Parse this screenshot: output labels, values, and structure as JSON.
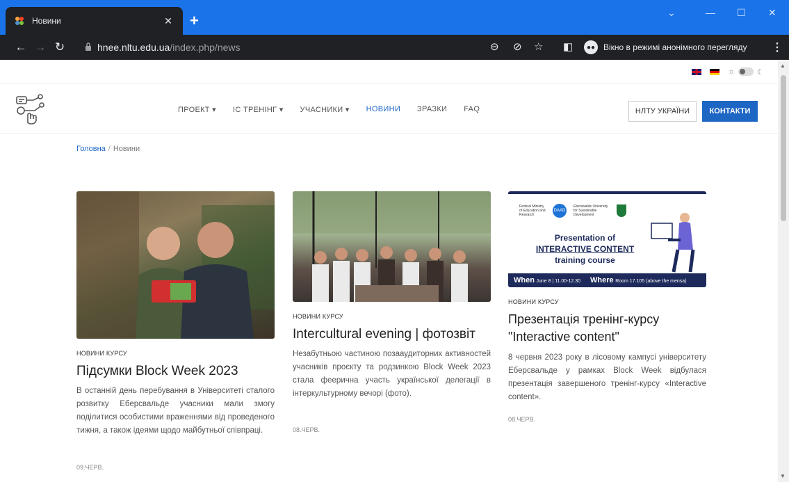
{
  "browser": {
    "tab_title": "Новини",
    "url_host": "hnee.nltu.edu.ua",
    "url_path": "/index.php/news",
    "incognito_label": "Вікно в режимі анонімного перегляду"
  },
  "site": {
    "nav": [
      "ПРОЕКТ ▾",
      "ІС ТРЕНІНГ ▾",
      "УЧАСНИКИ ▾",
      "НОВИНИ",
      "ЗРАЗКИ",
      "FAQ"
    ],
    "active_nav": "НОВИНИ",
    "btn_nltu": "НЛТУ УКРАЇНИ",
    "btn_contacts": "КОНТАКТИ",
    "accent_color": "#1e66c4"
  },
  "breadcrumb": {
    "home": "Головна",
    "current": "Новини"
  },
  "cards": [
    {
      "category": "НОВИНИ КУРСУ",
      "title": "Підсумки Block Week 2023",
      "text": "В останній день перебування в Університеті сталого розвитку Еберсвальде учасники мали змогу поділитися особистими враженнями від проведеного тижня, а також ідеями щодо майбутньої співпраці.",
      "date": "09.ЧЕРВ."
    },
    {
      "category": "НОВИНИ КУРСУ",
      "title": "Intercultural evening | фотозвіт",
      "text": "Незабутньою частиною позааудиторних активностей учасників проєкту та родзинкою Block Week 2023 стала феерична участь української делегації в інтеркультурному вечорі (фото).",
      "date": "08.ЧЕРВ."
    },
    {
      "category": "НОВИНИ КУРСУ",
      "title": "Презентація тренінг-курсу \"Interactive content\"",
      "text": "8 червня 2023 року в лісовому кампусі університету Еберсвальде у рамках Block Week відбулася презентація завершеного тренінг-курсу «Interactive content».",
      "date": "08.ЧЕРВ."
    }
  ],
  "poster": {
    "line1": "Presentation of",
    "line2": "INTERACTIVE CONTENT",
    "line3": "training course",
    "when_label": "When",
    "when_value": "June 8 | 11.00-12.30",
    "where_label": "Where",
    "where_value": "Room 17.105 (above the mensa)",
    "logo_ministry": "Federal Ministry of Education and Research",
    "logo_daad": "DAAD",
    "logo_hnee": "Eberswalde University for Sustainable Development"
  }
}
